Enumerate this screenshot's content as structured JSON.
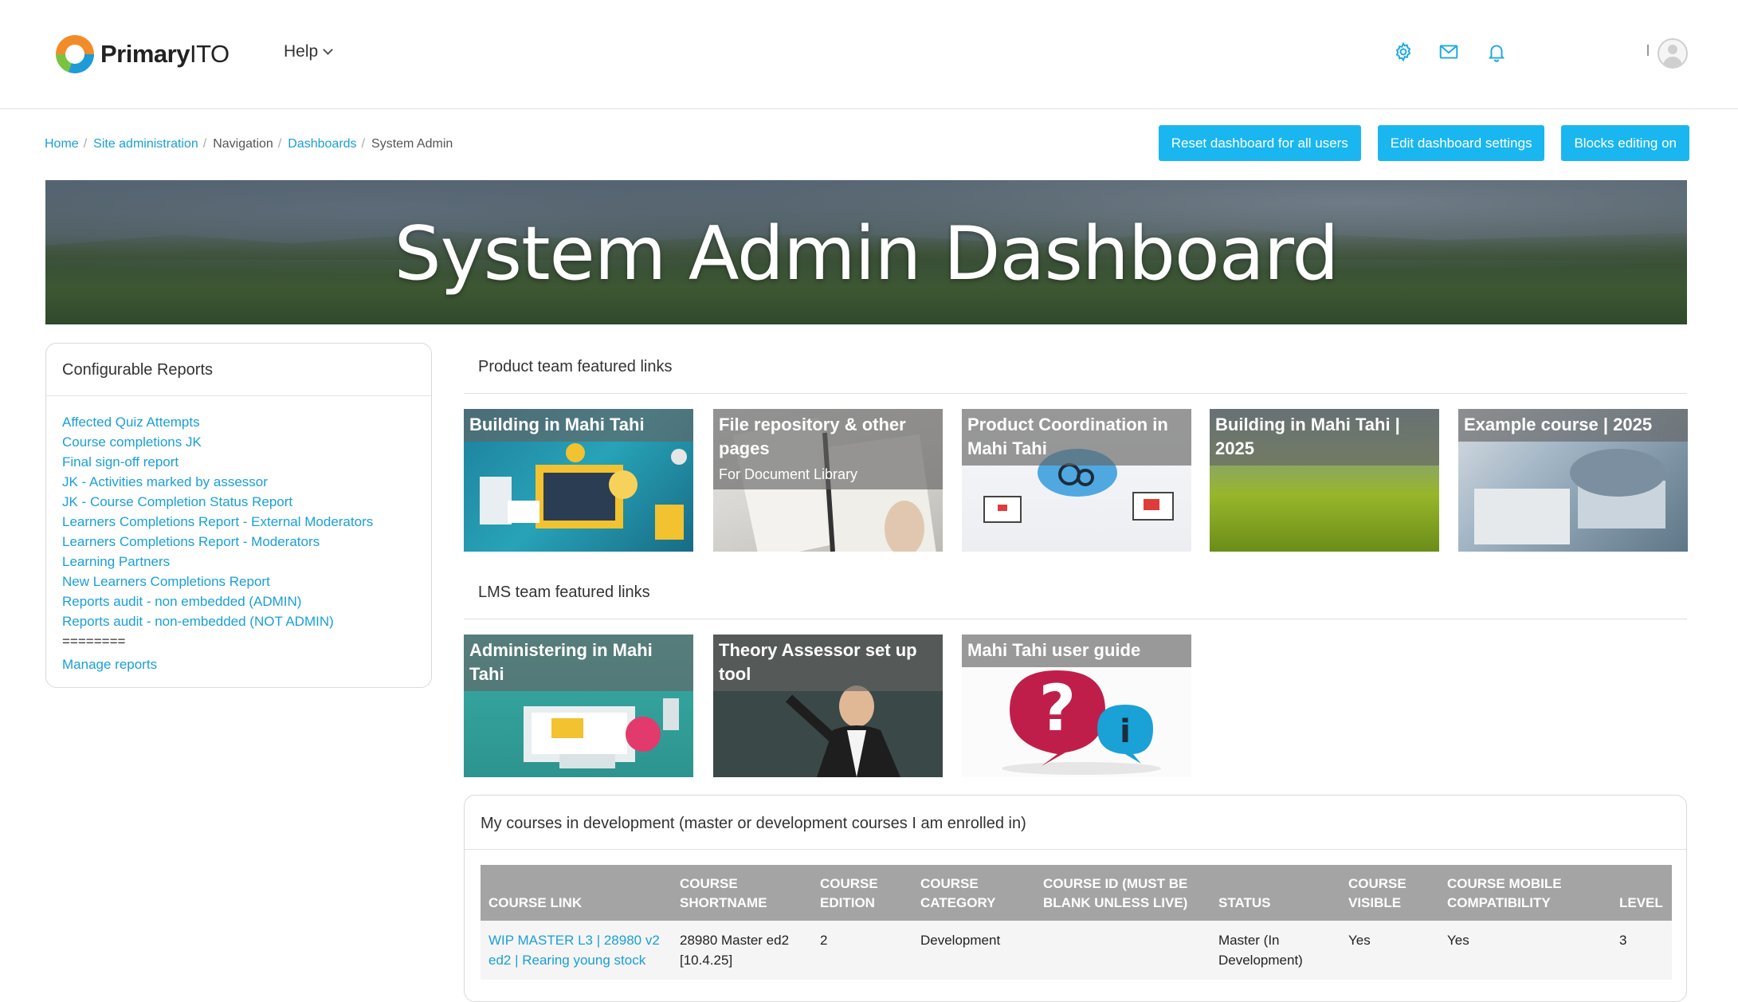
{
  "header": {
    "brand_bold": "Primary",
    "brand_light": "ITO",
    "help_label": "Help",
    "icons": [
      "gear-icon",
      "mail-icon",
      "bell-icon"
    ]
  },
  "breadcrumb": [
    {
      "label": "Home",
      "link": true
    },
    {
      "label": "Site administration",
      "link": true
    },
    {
      "label": "Navigation",
      "link": false
    },
    {
      "label": "Dashboards",
      "link": true
    },
    {
      "label": "System Admin",
      "link": false
    }
  ],
  "actions": {
    "reset": "Reset dashboard for all users",
    "edit": "Edit dashboard settings",
    "blocks": "Blocks editing on"
  },
  "banner": {
    "title": "System Admin Dashboard"
  },
  "reports": {
    "title": "Configurable Reports",
    "items": [
      "Affected Quiz Attempts",
      "Course completions JK",
      "Final sign-off report",
      "JK - Activities marked by assessor",
      "JK - Course Completion Status Report",
      "Learners Completions Report - External Moderators",
      "Learners Completions Report - Moderators",
      "Learning Partners",
      "New Learners Completions Report",
      "Reports audit - non embedded (ADMIN)",
      "Reports audit - non-embedded (NOT ADMIN)"
    ],
    "separator": "========",
    "manage": "Manage reports"
  },
  "product_links": {
    "title": "Product team featured links",
    "tiles": [
      {
        "title": "Building in Mahi Tahi",
        "subtitle": ""
      },
      {
        "title": "File repository & other pages",
        "subtitle": "For Document Library"
      },
      {
        "title": "Product Coordination in Mahi Tahi",
        "subtitle": ""
      },
      {
        "title": "Building in Mahi Tahi | 2025",
        "subtitle": ""
      },
      {
        "title": "Example course | 2025",
        "subtitle": ""
      }
    ]
  },
  "lms_links": {
    "title": "LMS team featured links",
    "tiles": [
      {
        "title": "Administering in Mahi Tahi"
      },
      {
        "title": "Theory Assessor set up tool"
      },
      {
        "title": "Mahi Tahi user guide"
      }
    ]
  },
  "courses": {
    "title": "My courses in development (master or development courses I am enrolled in)",
    "columns": [
      "COURSE LINK",
      "COURSE SHORTNAME",
      "COURSE EDITION",
      "COURSE CATEGORY",
      "COURSE ID (MUST BE BLANK UNLESS LIVE)",
      "STATUS",
      "COURSE VISIBLE",
      "COURSE MOBILE COMPATIBILITY",
      "LEVEL"
    ],
    "rows": [
      [
        "WIP MASTER L3 | 28980 v2 ed2 | Rearing young stock",
        "28980 Master ed2 [10.4.25]",
        "2",
        "Development",
        "",
        "Master (In Development)",
        "Yes",
        "Yes",
        "3"
      ]
    ]
  }
}
